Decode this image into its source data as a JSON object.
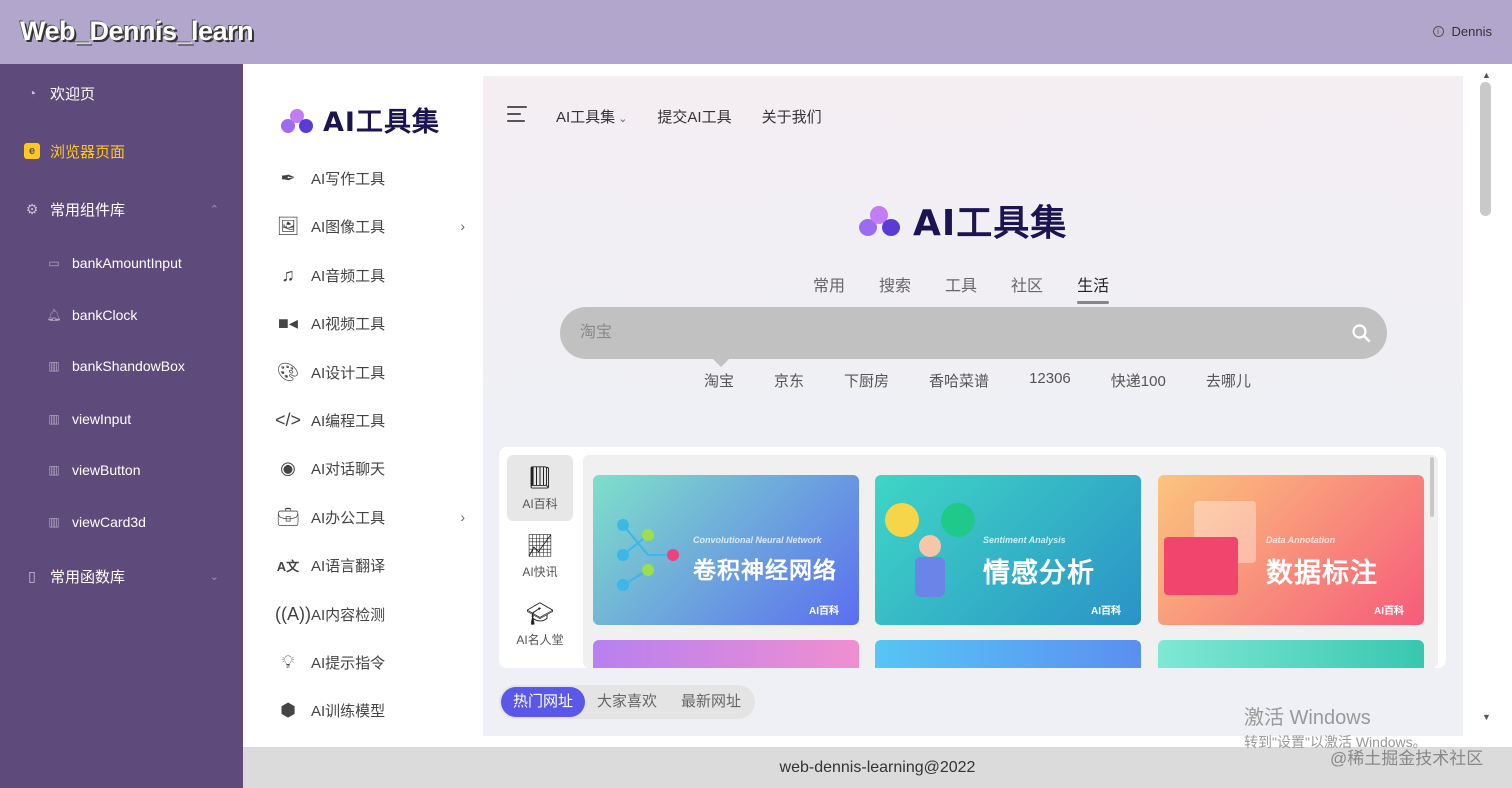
{
  "header": {
    "brand": "Web_Dennis_learn",
    "user": "Dennis"
  },
  "sidebar": {
    "items": [
      {
        "label": "欢迎页",
        "icon": "dashboard-icon"
      },
      {
        "label": "浏览器页面",
        "icon": "browser-icon",
        "active": true
      },
      {
        "label": "常用组件库",
        "icon": "gear-icon",
        "expanded": true
      },
      {
        "label": "常用函数库",
        "icon": "book-icon",
        "expanded": false
      }
    ],
    "sub_items": [
      {
        "label": "bankAmountInput"
      },
      {
        "label": "bankClock"
      },
      {
        "label": "bankShandowBox"
      },
      {
        "label": "viewInput"
      },
      {
        "label": "viewButton"
      },
      {
        "label": "viewCard3d"
      }
    ]
  },
  "inner": {
    "logo_text": "AI工具集",
    "nav": [
      {
        "label": "AI写作工具",
        "icon": "feather-icon"
      },
      {
        "label": "AI图像工具",
        "icon": "images-icon",
        "has_children": true
      },
      {
        "label": "AI音频工具",
        "icon": "music-icon"
      },
      {
        "label": "AI视频工具",
        "icon": "video-icon"
      },
      {
        "label": "AI设计工具",
        "icon": "palette-icon"
      },
      {
        "label": "AI编程工具",
        "icon": "code-icon"
      },
      {
        "label": "AI对话聊天",
        "icon": "chat-icon"
      },
      {
        "label": "AI办公工具",
        "icon": "briefcase-icon",
        "has_children": true
      },
      {
        "label": "AI语言翻译",
        "icon": "translate-icon"
      },
      {
        "label": "AI内容检测",
        "icon": "antenna-icon"
      },
      {
        "label": "AI提示指令",
        "icon": "lightbulb-icon"
      },
      {
        "label": "AI训练模型",
        "icon": "cubes-icon"
      }
    ],
    "top_menu": [
      "AI工具集",
      "提交AI工具",
      "关于我们"
    ],
    "tabs": [
      "常用",
      "搜索",
      "工具",
      "社区",
      "生活"
    ],
    "active_tab": "生活",
    "search": {
      "placeholder": "淘宝"
    },
    "quick_links": [
      "淘宝",
      "京东",
      "下厨房",
      "香哈菜谱",
      "12306",
      "快递100",
      "去哪儿"
    ],
    "categories": [
      {
        "label": "AI百科",
        "icon": "book-icon",
        "active": true
      },
      {
        "label": "AI快讯",
        "icon": "chart-icon"
      },
      {
        "label": "AI名人堂",
        "icon": "graduate-icon"
      }
    ],
    "cards": [
      {
        "en": "Convolutional Neural Network",
        "cn": "卷积神经网络",
        "badge": "AI百科",
        "color_a": "#7fe0c9",
        "color_b": "#5b6ef0"
      },
      {
        "en": "Sentiment Analysis",
        "cn": "情感分析",
        "badge": "AI百科",
        "color_a": "#3fd6c6",
        "color_b": "#2a93c7"
      },
      {
        "en": "Data Annotation",
        "cn": "数据标注",
        "badge": "AI百科",
        "color_a": "#fbc57d",
        "color_b": "#f65b7a"
      }
    ],
    "bottom_tabs": [
      "热门网址",
      "大家喜欢",
      "最新网址"
    ]
  },
  "footer": {
    "text": "web-dennis-learning@2022"
  },
  "overlay": {
    "activate_title": "激活 Windows",
    "activate_sub": "转到\"设置\"以激活 Windows。",
    "watermark": "@稀土掘金技术社区"
  }
}
